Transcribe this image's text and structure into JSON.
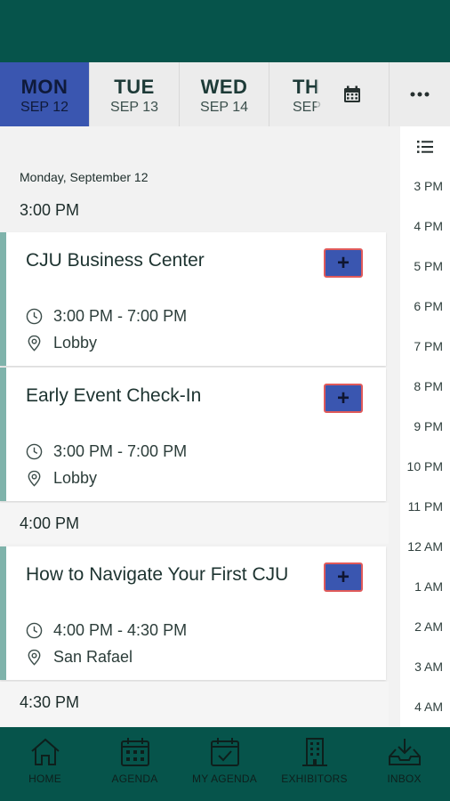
{
  "days": [
    {
      "name": "MON",
      "date": "SEP 12"
    },
    {
      "name": "TUE",
      "date": "SEP 13"
    },
    {
      "name": "WED",
      "date": "SEP 14"
    },
    {
      "name": "TH",
      "date": "SEP"
    }
  ],
  "selected_day": "MON",
  "day_heading": "Monday, September 12",
  "time_headers": [
    "3:00 PM",
    "4:00 PM",
    "4:30 PM"
  ],
  "sessions": [
    {
      "title": "CJU Business Center",
      "time": "3:00 PM - 7:00 PM",
      "location": "Lobby",
      "add_label": "+"
    },
    {
      "title": "Early Event Check-In",
      "time": "3:00 PM - 7:00 PM",
      "location": "Lobby",
      "add_label": "+"
    },
    {
      "title": "How to Navigate Your First CJU",
      "time": "4:00 PM - 4:30 PM",
      "location": "San Rafael",
      "add_label": "+"
    }
  ],
  "timeline": [
    "3 PM",
    "4 PM",
    "5 PM",
    "6 PM",
    "7 PM",
    "8 PM",
    "9 PM",
    "10 PM",
    "11 PM",
    "12 AM",
    "1 AM",
    "2 AM",
    "3 AM",
    "4 AM"
  ],
  "bottom_nav": [
    {
      "label": "HOME",
      "icon": "home-icon"
    },
    {
      "label": "AGENDA",
      "icon": "calendar-grid-icon"
    },
    {
      "label": "MY AGENDA",
      "icon": "calendar-check-icon"
    },
    {
      "label": "EXHIBITORS",
      "icon": "building-icon"
    },
    {
      "label": "INBOX",
      "icon": "inbox-download-icon"
    }
  ],
  "colors": {
    "brand": "#06544b",
    "active_tab": "#3a56b0",
    "add_button": "#3a56b0",
    "add_button_border": "#e05a5a",
    "card_accent": "#7fb3ab"
  }
}
